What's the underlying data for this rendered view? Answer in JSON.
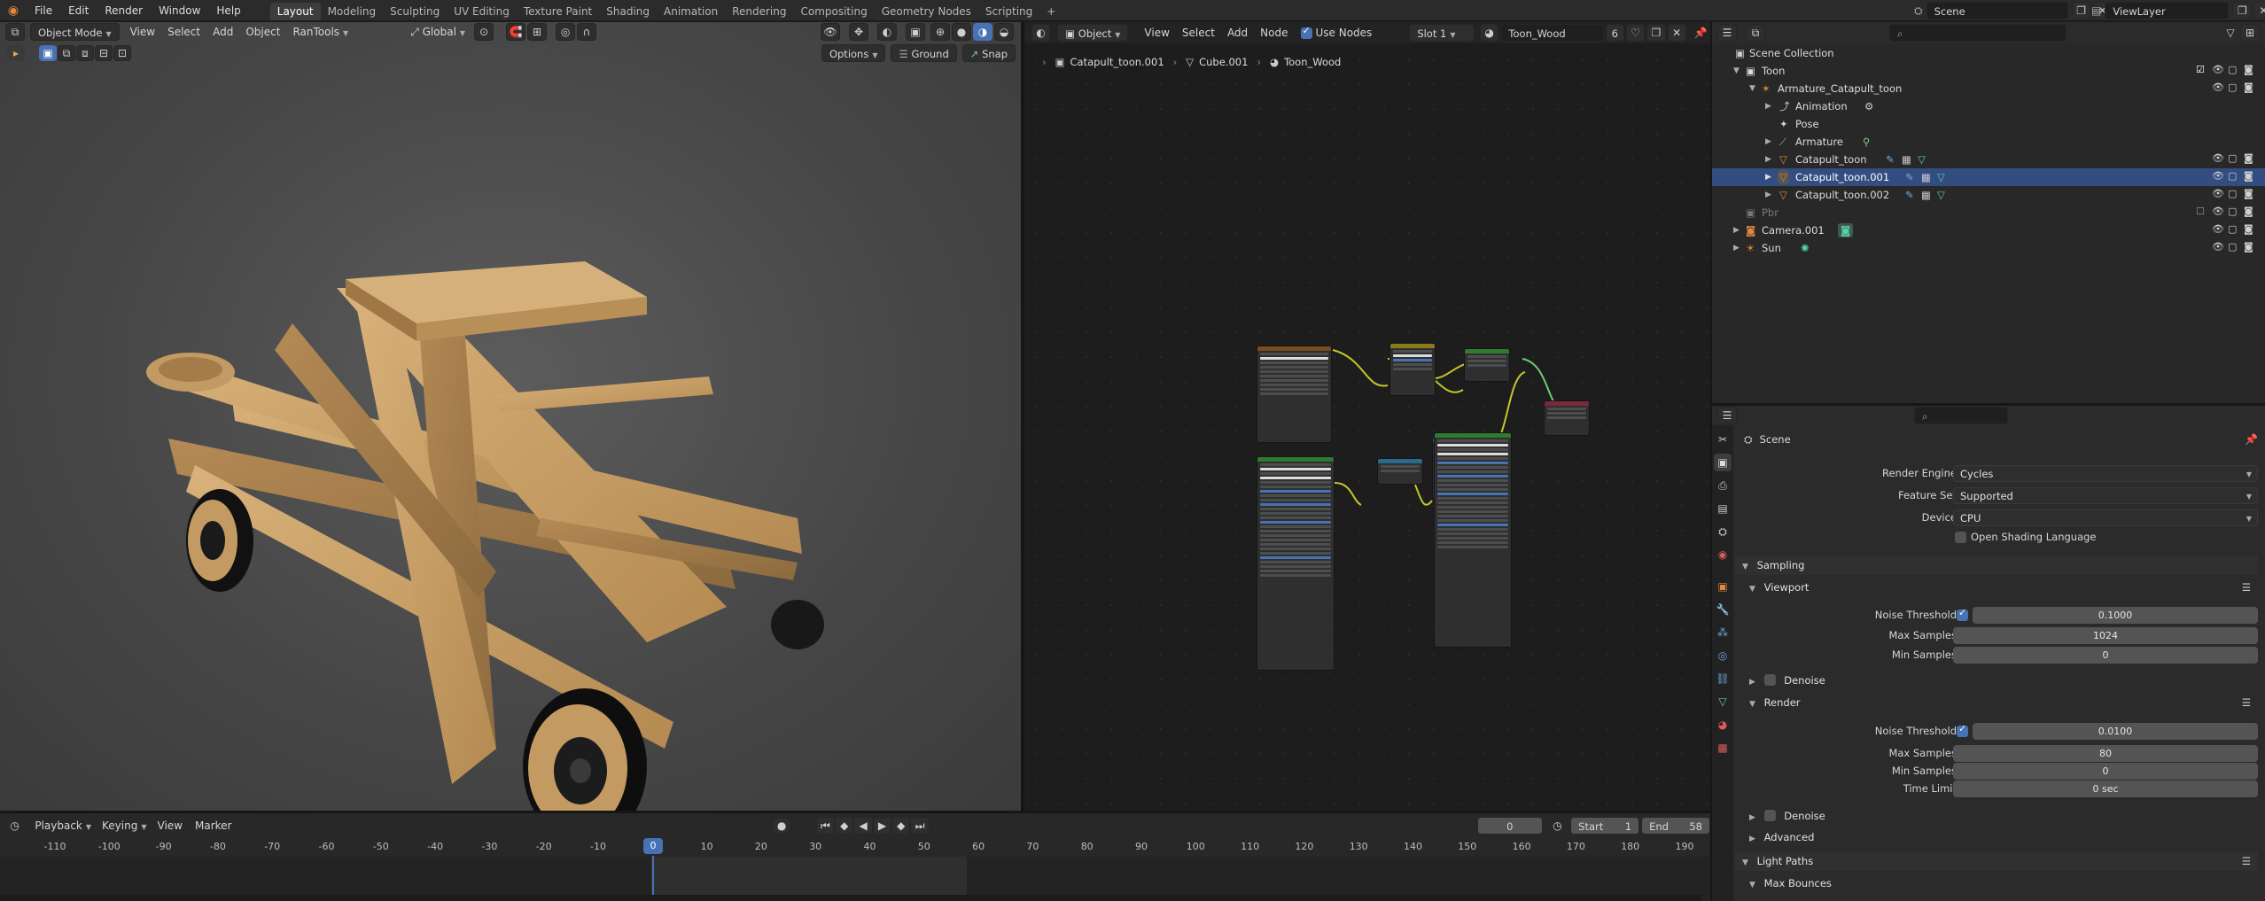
{
  "topbar": {
    "menus": [
      "File",
      "Edit",
      "Render",
      "Window",
      "Help"
    ],
    "workspaces": [
      "Layout",
      "Modeling",
      "Sculpting",
      "UV Editing",
      "Texture Paint",
      "Shading",
      "Animation",
      "Rendering",
      "Compositing",
      "Geometry Nodes",
      "Scripting"
    ],
    "active_workspace": "Layout",
    "scene": "Scene",
    "view_layer": "ViewLayer"
  },
  "viewport": {
    "mode": "Object Mode",
    "menus": [
      "View",
      "Select",
      "Add",
      "Object",
      "RanTools"
    ],
    "orientation": "Global",
    "options_label": "Options",
    "ground_label": "Ground",
    "snap_label": "Snap"
  },
  "node_editor": {
    "type": "Object",
    "menus": [
      "View",
      "Select",
      "Add",
      "Node"
    ],
    "use_nodes_label": "Use Nodes",
    "slot": "Slot 1",
    "material": "Toon_Wood",
    "users": "6",
    "breadcrumb": [
      "Catapult_toon.001",
      "Cube.001",
      "Toon_Wood"
    ]
  },
  "outliner": {
    "root": "Scene Collection",
    "rows": [
      {
        "label": "Toon",
        "indent": 1
      },
      {
        "label": "Armature_Catapult_toon",
        "indent": 2
      },
      {
        "label": "Animation",
        "indent": 3
      },
      {
        "label": "Pose",
        "indent": 3
      },
      {
        "label": "Armature",
        "indent": 3
      },
      {
        "label": "Catapult_toon",
        "indent": 3
      },
      {
        "label": "Catapult_toon.001",
        "indent": 3
      },
      {
        "label": "Catapult_toon.002",
        "indent": 3
      },
      {
        "label": "Pbr",
        "indent": 1
      },
      {
        "label": "Camera.001",
        "indent": 1
      },
      {
        "label": "Sun",
        "indent": 1
      }
    ]
  },
  "properties": {
    "context": "Scene",
    "render_engine_label": "Render Engine",
    "render_engine": "Cycles",
    "feature_set_label": "Feature Set",
    "feature_set": "Supported",
    "device_label": "Device",
    "device": "CPU",
    "osl_label": "Open Shading Language",
    "sampling": "Sampling",
    "viewport": "Viewport",
    "noise_threshold_label": "Noise Threshold",
    "viewport_noise_threshold": "0.1000",
    "max_samples_label": "Max Samples",
    "viewport_max_samples": "1024",
    "min_samples_label": "Min Samples",
    "viewport_min_samples": "0",
    "denoise_label": "Denoise",
    "render": "Render",
    "render_noise_threshold": "0.0100",
    "render_max_samples": "80",
    "render_min_samples": "0",
    "time_limit_label": "Time Limit",
    "time_limit": "0 sec",
    "advanced": "Advanced",
    "light_paths": "Light Paths",
    "max_bounces": "Max Bounces"
  },
  "timeline": {
    "menus": [
      "Playback",
      "Keying",
      "View",
      "Marker"
    ],
    "current_frame": "0",
    "start_label": "Start",
    "start": "1",
    "end_label": "End",
    "end": "58",
    "ticks": [
      "-110",
      "-100",
      "-90",
      "-80",
      "-70",
      "-60",
      "-50",
      "-40",
      "-30",
      "-20",
      "-10",
      "0",
      "10",
      "20",
      "30",
      "40",
      "50",
      "60",
      "70",
      "80",
      "90",
      "100",
      "110",
      "120",
      "130",
      "140",
      "150",
      "160",
      "170",
      "180",
      "190"
    ]
  },
  "colors": {
    "accent": "#4772b3",
    "selection": "#334d80",
    "wood": "#c49a63",
    "frame_marker": "#4772b3"
  }
}
